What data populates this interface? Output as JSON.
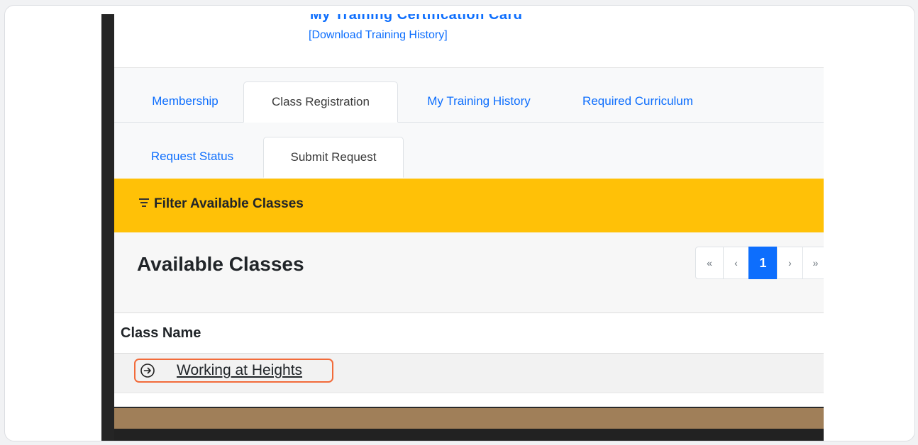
{
  "header": {
    "cut_title": "My Training Certification Card",
    "download_link": "[Download Training History]"
  },
  "main_tabs": [
    {
      "label": "Membership",
      "active": false
    },
    {
      "label": "Class Registration",
      "active": true
    },
    {
      "label": "My Training History",
      "active": false
    },
    {
      "label": "Required Curriculum",
      "active": false
    }
  ],
  "sub_tabs": [
    {
      "label": "Request Status",
      "active": false
    },
    {
      "label": "Submit Request",
      "active": true
    }
  ],
  "filter": {
    "label": "Filter Available Classes",
    "icon": "filter-icon"
  },
  "classes": {
    "title": "Available Classes",
    "pager": {
      "first": "«",
      "prev": "‹",
      "current": "1",
      "next": "›",
      "last": "»"
    },
    "column_header": "Class Name",
    "rows": [
      {
        "name": "Working at Heights",
        "icon": "circle-arrow-right-icon"
      }
    ]
  },
  "colors": {
    "accent_blue": "#0d6efd",
    "filter_yellow": "#ffc107",
    "highlight_orange": "#f26b3a",
    "footer_brown": "#a07f59"
  }
}
